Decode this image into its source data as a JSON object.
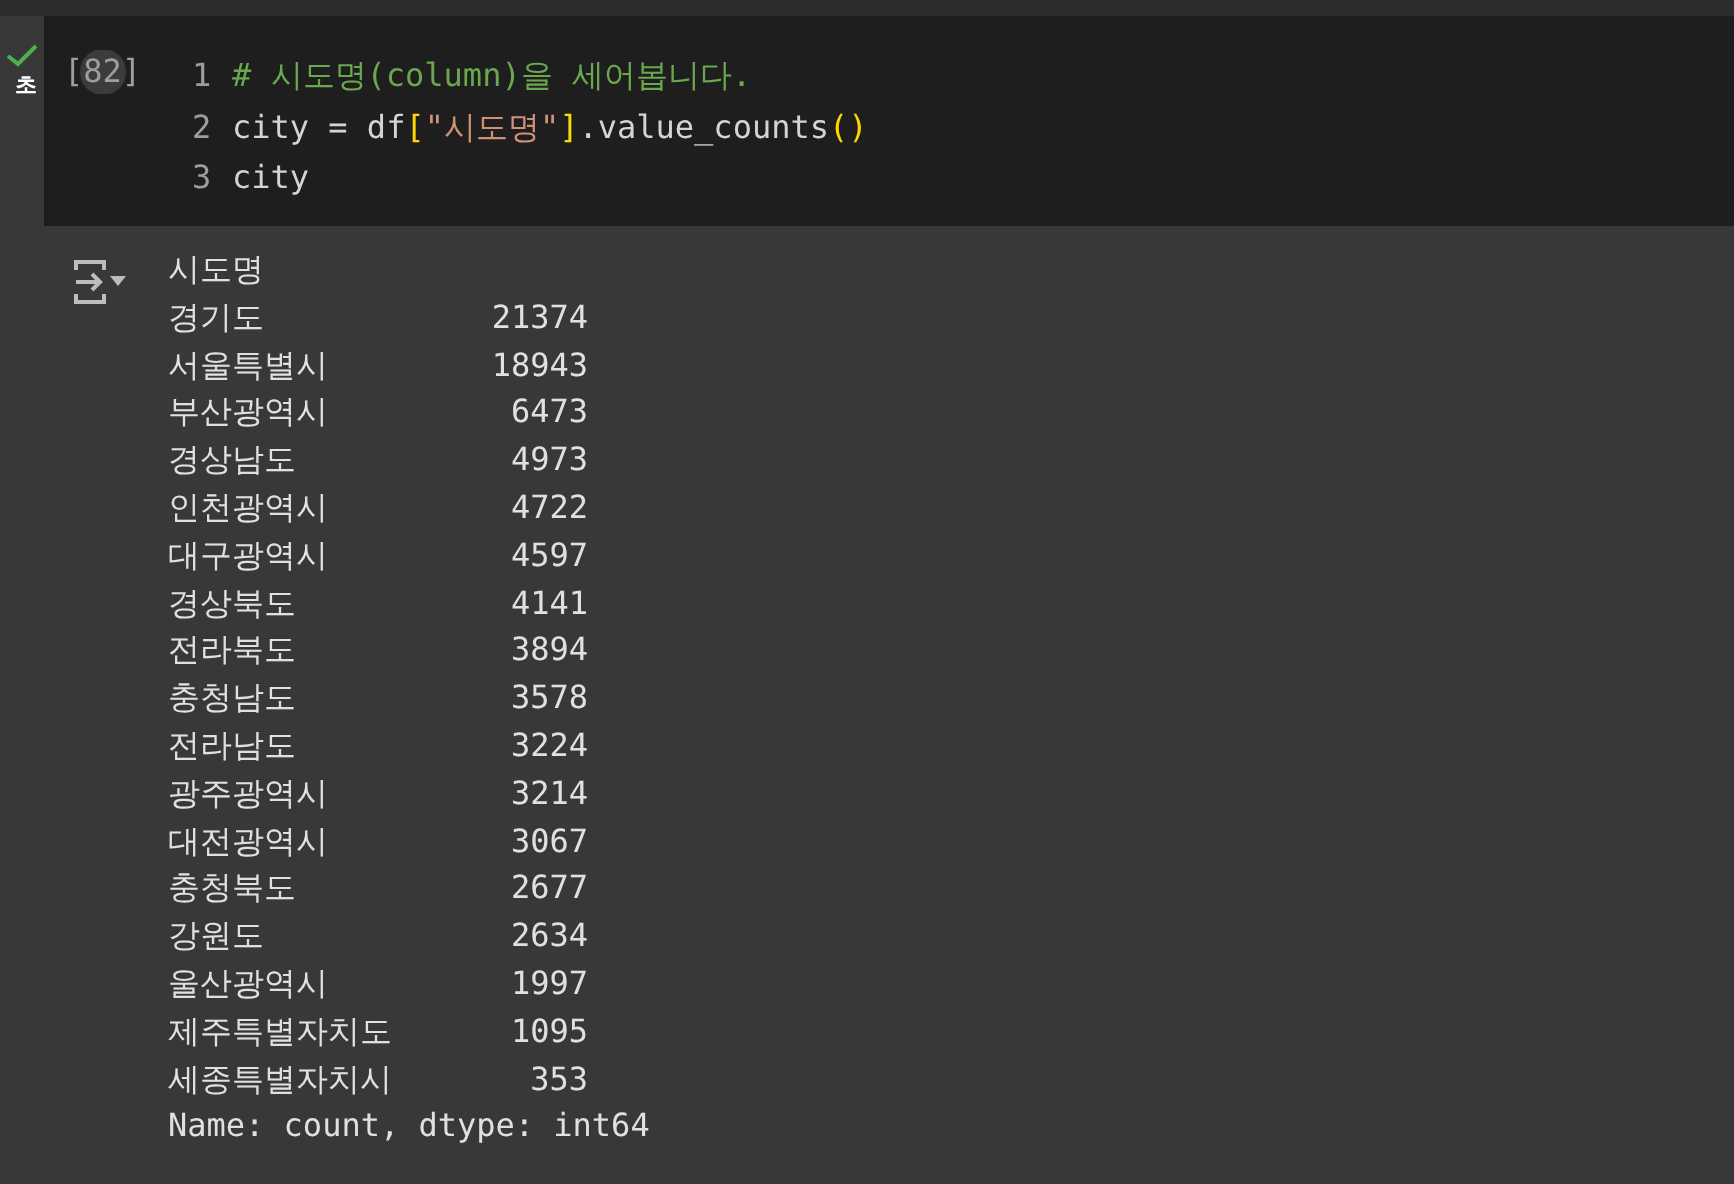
{
  "gutter": {
    "status_text": "초"
  },
  "cell": {
    "execution_count": "[82]",
    "lines": [
      {
        "number": "1",
        "tokens": [
          {
            "kind": "comment",
            "text": "# 시도명(column)을 세어봅니다."
          }
        ]
      },
      {
        "number": "2",
        "tokens": [
          {
            "kind": "plain",
            "text": "city = df"
          },
          {
            "kind": "bracket",
            "text": "["
          },
          {
            "kind": "string",
            "text": "\"시도명\""
          },
          {
            "kind": "bracket",
            "text": "]"
          },
          {
            "kind": "plain",
            "text": ".value_counts"
          },
          {
            "kind": "bracket",
            "text": "()"
          }
        ]
      },
      {
        "number": "3",
        "tokens": [
          {
            "kind": "plain",
            "text": "city"
          }
        ]
      }
    ]
  },
  "output": {
    "header": "시도명",
    "rows": [
      {
        "name": "경기도",
        "count": "21374"
      },
      {
        "name": "서울특별시",
        "count": "18943"
      },
      {
        "name": "부산광역시",
        "count": "6473"
      },
      {
        "name": "경상남도",
        "count": "4973"
      },
      {
        "name": "인천광역시",
        "count": "4722"
      },
      {
        "name": "대구광역시",
        "count": "4597"
      },
      {
        "name": "경상북도",
        "count": "4141"
      },
      {
        "name": "전라북도",
        "count": "3894"
      },
      {
        "name": "충청남도",
        "count": "3578"
      },
      {
        "name": "전라남도",
        "count": "3224"
      },
      {
        "name": "광주광역시",
        "count": "3214"
      },
      {
        "name": "대전광역시",
        "count": "3067"
      },
      {
        "name": "충청북도",
        "count": "2677"
      },
      {
        "name": "강원도",
        "count": "2634"
      },
      {
        "name": "울산광역시",
        "count": "1997"
      },
      {
        "name": "제주특별자치도",
        "count": "1095"
      },
      {
        "name": "세종특별자치시",
        "count": "353"
      }
    ],
    "footer": "Name: count, dtype: int64"
  }
}
